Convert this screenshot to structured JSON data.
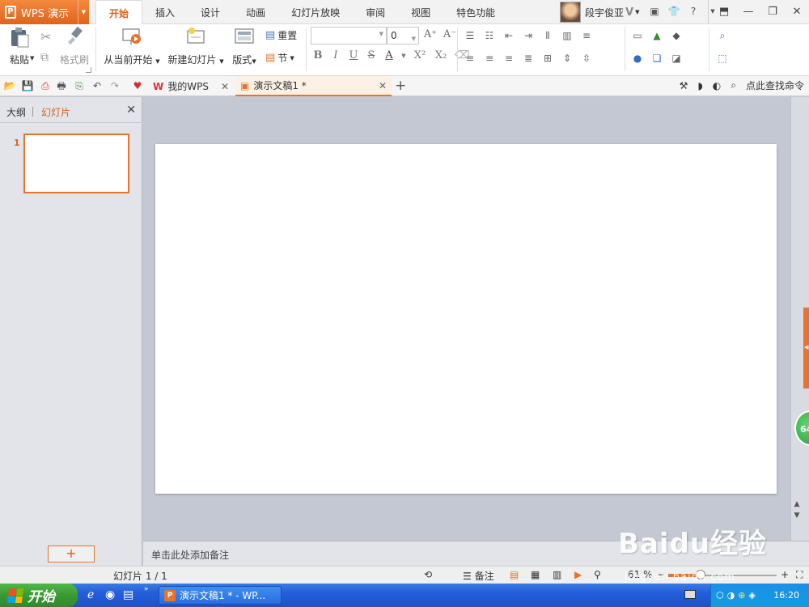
{
  "app": {
    "title": "WPS 演示",
    "logo_letter": "P"
  },
  "tabs": [
    "开始",
    "插入",
    "设计",
    "动画",
    "幻灯片放映",
    "审阅",
    "视图",
    "特色功能"
  ],
  "user": {
    "name": "段宇俊亚",
    "badge": "V"
  },
  "title_icons": [
    "shirt",
    "?"
  ],
  "ribbon": {
    "paste": "粘贴",
    "format_painter": "格式刷",
    "play_from_current": "从当前开始",
    "new_slide": "新建幻灯片",
    "layout": "版式",
    "reset": "重置",
    "section": "节",
    "font_name": "",
    "font_size": "0",
    "bold": "B",
    "italic": "I",
    "underline": "U",
    "strike": "S",
    "font_color": "A",
    "superscript": "X²",
    "subscript": "X₂",
    "grow": "A⁺",
    "shrink": "A⁻"
  },
  "doc_tabs": [
    {
      "label": "我的WPS",
      "active": false
    },
    {
      "label": "演示文稿1 *",
      "active": true
    }
  ],
  "find_command": "点此查找命令",
  "left_pane": {
    "outline_tab": "大纲",
    "slides_tab": "幻灯片",
    "slide_number": "1",
    "add_button": "+"
  },
  "notes_placeholder": "单击此处添加备注",
  "status": {
    "slide_info": "幻灯片 1 / 1",
    "notes": "备注",
    "zoom": "61 %",
    "zoom_fraction": 0.3
  },
  "side_badge": "64",
  "taskbar": {
    "start": "开始",
    "task_item": "演示文稿1 * - WP...",
    "clock": "16:20"
  },
  "watermark": {
    "logo": "Baidu经验",
    "url": "jingyan.baidu.com"
  },
  "colors": {
    "accent": "#e8742a",
    "accent_text": "#d9601d",
    "taskbar": "#245edb",
    "start_green": "#3a9a33"
  }
}
